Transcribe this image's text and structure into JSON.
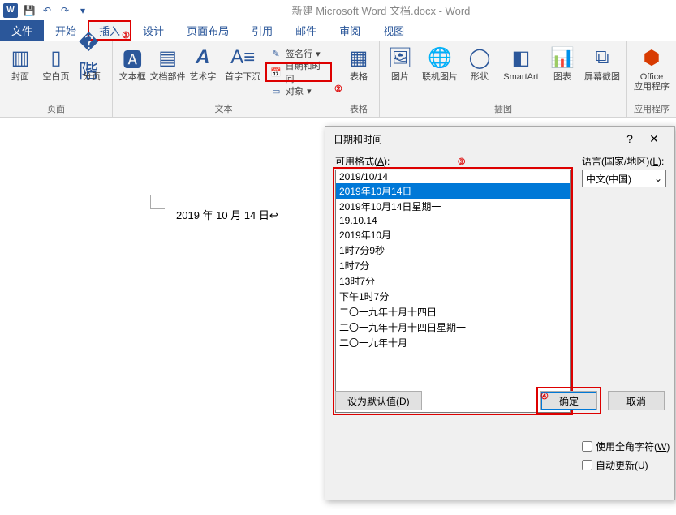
{
  "window": {
    "title": "新建 Microsoft Word 文档.docx - Word"
  },
  "qat": {
    "save": "保存",
    "undo": "撤销",
    "redo": "恢复"
  },
  "tabs": {
    "file": "文件",
    "home": "开始",
    "insert": "插入",
    "design": "设计",
    "layout": "页面布局",
    "references": "引用",
    "mailings": "邮件",
    "review": "审阅",
    "view": "视图"
  },
  "markers": {
    "m1": "①",
    "m2": "②",
    "m3": "③",
    "m4": "④"
  },
  "ribbon": {
    "pages": {
      "label": "页面",
      "cover": "封面",
      "blank": "空白页",
      "break": "分页"
    },
    "text": {
      "label": "文本",
      "textbox": "文本框",
      "parts": "文档部件",
      "wordart": "艺术字",
      "dropcap": "首字下沉",
      "signature": "签名行",
      "datetime": "日期和时间",
      "object": "对象"
    },
    "tables": {
      "label": "表格",
      "table": "表格"
    },
    "illust": {
      "label": "插图",
      "pic": "图片",
      "online": "联机图片",
      "shapes": "形状",
      "smartart": "SmartArt",
      "chart": "图表",
      "screenshot": "屏幕截图"
    },
    "apps": {
      "label": "应用程序",
      "office": "Office\n应用程序"
    }
  },
  "document": {
    "inserted_date_text": "2019 年 10 月 14 日"
  },
  "dialog": {
    "title": "日期和时间",
    "formats_label_pre": "可用格式(",
    "formats_label_key": "A",
    "formats_label_post": "):",
    "formats": [
      "2019/10/14",
      "2019年10月14日",
      "2019年10月14日星期一",
      "19.10.14",
      "2019年10月",
      "1时7分9秒",
      "1时7分",
      "13时7分",
      "下午1时7分",
      "二〇一九年十月十四日",
      "二〇一九年十月十四日星期一",
      "二〇一九年十月"
    ],
    "selected_index": 1,
    "lang_label_pre": "语言(国家/地区)(",
    "lang_label_key": "L",
    "lang_label_post": "):",
    "lang_value": "中文(中国)",
    "fullwidth_pre": "使用全角字符(",
    "fullwidth_key": "W",
    "fullwidth_post": ")",
    "autoupdate_pre": "自动更新(",
    "autoupdate_key": "U",
    "autoupdate_post": ")",
    "default_btn_pre": "设为默认值(",
    "default_btn_key": "D",
    "default_btn_post": ")",
    "ok": "确定",
    "cancel": "取消"
  }
}
